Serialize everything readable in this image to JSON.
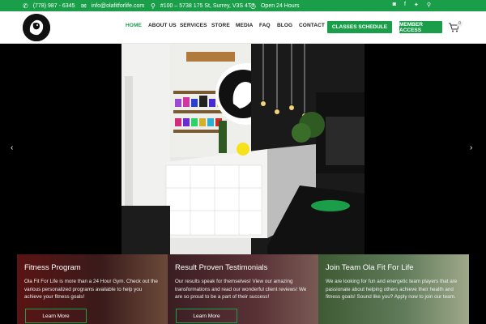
{
  "topbar": {
    "phone": "(778) 987 - 6345",
    "email": "info@olafitforlife.com",
    "address": "#100 – 5738 175 St, Surrey, V3S 4T7",
    "hours": "Open 24 Hours",
    "social_icons": [
      "instagram-icon",
      "facebook-icon",
      "twitter-icon",
      "search-icon"
    ]
  },
  "header": {
    "nav": [
      "HOME",
      "ABOUT US",
      "SERVICES",
      "STORE",
      "MEDIA",
      "FAQ",
      "BLOG",
      "CONTACT"
    ],
    "active_nav": "HOME",
    "classes_button": "CLASSES SCHEDULE",
    "member_button": "MEMBER ACCESS",
    "cart_count": "0"
  },
  "hero": {
    "prev_arrow": "‹",
    "next_arrow": "›"
  },
  "cards": [
    {
      "title": "Fitness Program",
      "text": "Ola Fit For Life is more than a 24 Hour Gym. Check out the various personalized programs available to help you achieve your fitness goals!",
      "button": "Learn More"
    },
    {
      "title": "Result Proven Testimonials",
      "text": "Our results speak for themselves! View our amazing transformations and read our wonderful client reviews! We are so proud to be a part of their success!",
      "button": "Learn More"
    },
    {
      "title": "Join Team Ola Fit For Life",
      "text": "We are looking for fun and energetic team players that are passionate about helping others achieve their health and fitness goals! Sound like you? Apply now to join our team.",
      "button": "Learn More"
    }
  ],
  "colors": {
    "brand_green": "#1a9e4a",
    "dark": "#111111"
  }
}
